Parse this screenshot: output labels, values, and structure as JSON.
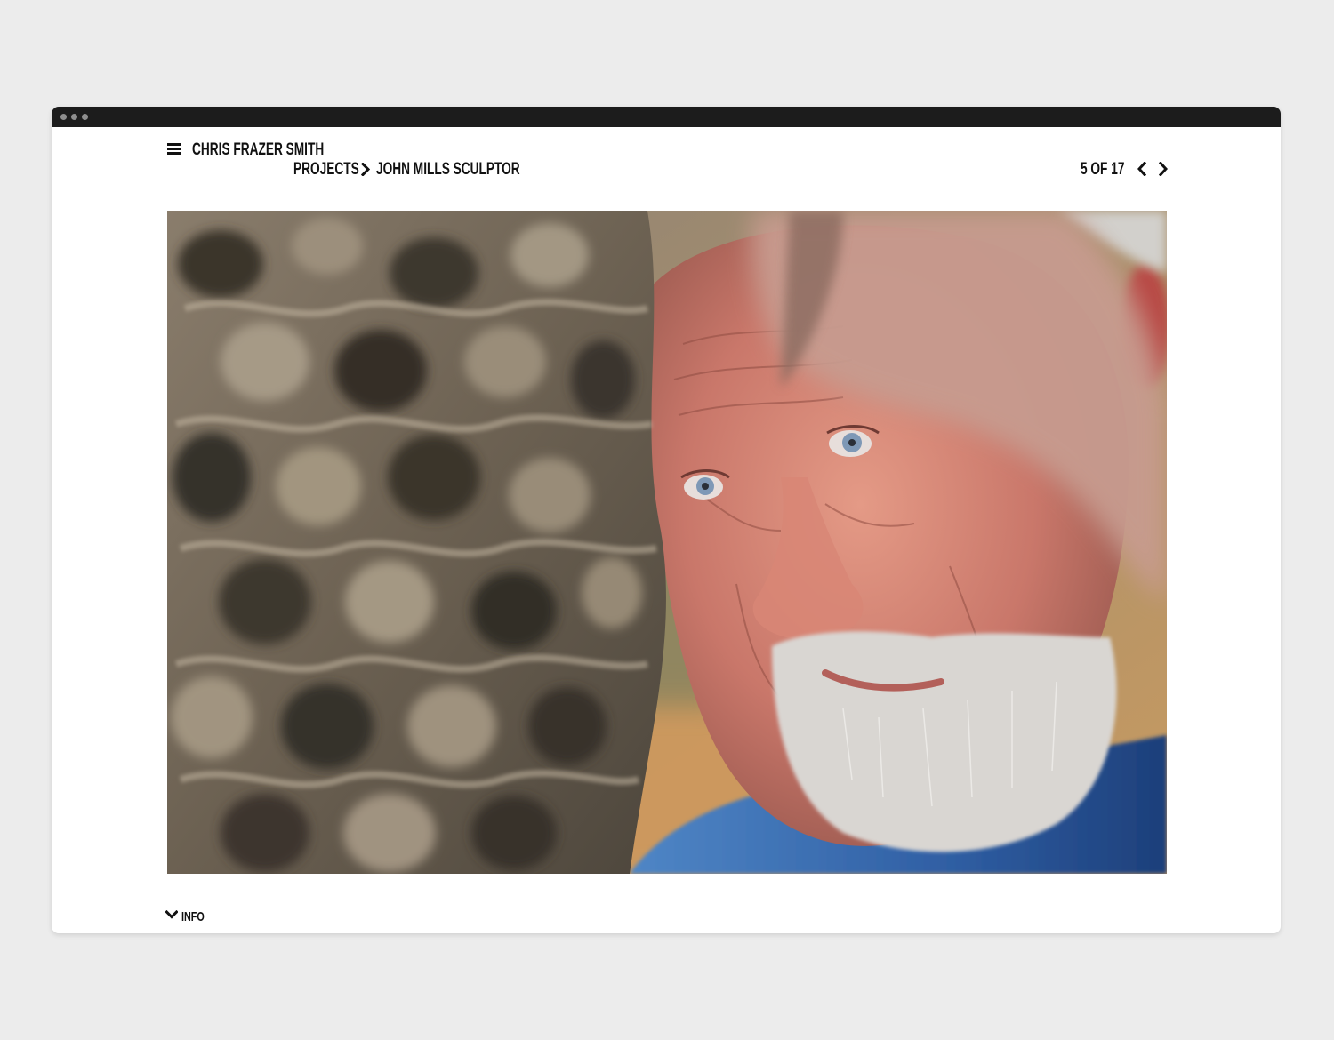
{
  "header": {
    "site_title": "CHRIS FRAZER SMITH",
    "breadcrumb": {
      "parent": "PROJECTS",
      "current": "JOHN MILLS SCULPTOR"
    }
  },
  "gallery": {
    "counter": "5 OF 17",
    "prev_icon": "chevron-left-icon",
    "next_icon": "chevron-right-icon"
  },
  "footer": {
    "info_label": "INFO",
    "info_icon": "chevron-down-icon"
  },
  "icons": {
    "menu": "hamburger-menu-icon",
    "breadcrumb_separator": "chevron-right-icon"
  },
  "colors": {
    "page_background": "#ececec",
    "window_background": "#ffffff",
    "titlebar": "#1c1c1c",
    "text": "#111111"
  }
}
